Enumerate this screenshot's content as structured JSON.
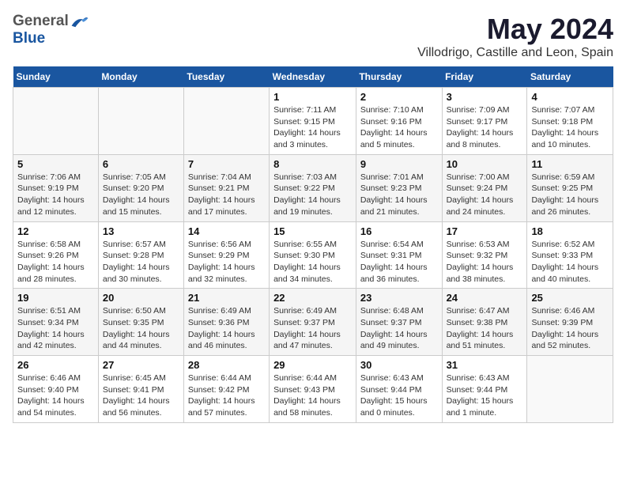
{
  "header": {
    "logo_general": "General",
    "logo_blue": "Blue",
    "title": "May 2024",
    "subtitle": "Villodrigo, Castille and Leon, Spain"
  },
  "weekdays": [
    "Sunday",
    "Monday",
    "Tuesday",
    "Wednesday",
    "Thursday",
    "Friday",
    "Saturday"
  ],
  "weeks": [
    [
      {
        "day": "",
        "info": ""
      },
      {
        "day": "",
        "info": ""
      },
      {
        "day": "",
        "info": ""
      },
      {
        "day": "1",
        "info": "Sunrise: 7:11 AM\nSunset: 9:15 PM\nDaylight: 14 hours and 3 minutes."
      },
      {
        "day": "2",
        "info": "Sunrise: 7:10 AM\nSunset: 9:16 PM\nDaylight: 14 hours and 5 minutes."
      },
      {
        "day": "3",
        "info": "Sunrise: 7:09 AM\nSunset: 9:17 PM\nDaylight: 14 hours and 8 minutes."
      },
      {
        "day": "4",
        "info": "Sunrise: 7:07 AM\nSunset: 9:18 PM\nDaylight: 14 hours and 10 minutes."
      }
    ],
    [
      {
        "day": "5",
        "info": "Sunrise: 7:06 AM\nSunset: 9:19 PM\nDaylight: 14 hours and 12 minutes."
      },
      {
        "day": "6",
        "info": "Sunrise: 7:05 AM\nSunset: 9:20 PM\nDaylight: 14 hours and 15 minutes."
      },
      {
        "day": "7",
        "info": "Sunrise: 7:04 AM\nSunset: 9:21 PM\nDaylight: 14 hours and 17 minutes."
      },
      {
        "day": "8",
        "info": "Sunrise: 7:03 AM\nSunset: 9:22 PM\nDaylight: 14 hours and 19 minutes."
      },
      {
        "day": "9",
        "info": "Sunrise: 7:01 AM\nSunset: 9:23 PM\nDaylight: 14 hours and 21 minutes."
      },
      {
        "day": "10",
        "info": "Sunrise: 7:00 AM\nSunset: 9:24 PM\nDaylight: 14 hours and 24 minutes."
      },
      {
        "day": "11",
        "info": "Sunrise: 6:59 AM\nSunset: 9:25 PM\nDaylight: 14 hours and 26 minutes."
      }
    ],
    [
      {
        "day": "12",
        "info": "Sunrise: 6:58 AM\nSunset: 9:26 PM\nDaylight: 14 hours and 28 minutes."
      },
      {
        "day": "13",
        "info": "Sunrise: 6:57 AM\nSunset: 9:28 PM\nDaylight: 14 hours and 30 minutes."
      },
      {
        "day": "14",
        "info": "Sunrise: 6:56 AM\nSunset: 9:29 PM\nDaylight: 14 hours and 32 minutes."
      },
      {
        "day": "15",
        "info": "Sunrise: 6:55 AM\nSunset: 9:30 PM\nDaylight: 14 hours and 34 minutes."
      },
      {
        "day": "16",
        "info": "Sunrise: 6:54 AM\nSunset: 9:31 PM\nDaylight: 14 hours and 36 minutes."
      },
      {
        "day": "17",
        "info": "Sunrise: 6:53 AM\nSunset: 9:32 PM\nDaylight: 14 hours and 38 minutes."
      },
      {
        "day": "18",
        "info": "Sunrise: 6:52 AM\nSunset: 9:33 PM\nDaylight: 14 hours and 40 minutes."
      }
    ],
    [
      {
        "day": "19",
        "info": "Sunrise: 6:51 AM\nSunset: 9:34 PM\nDaylight: 14 hours and 42 minutes."
      },
      {
        "day": "20",
        "info": "Sunrise: 6:50 AM\nSunset: 9:35 PM\nDaylight: 14 hours and 44 minutes."
      },
      {
        "day": "21",
        "info": "Sunrise: 6:49 AM\nSunset: 9:36 PM\nDaylight: 14 hours and 46 minutes."
      },
      {
        "day": "22",
        "info": "Sunrise: 6:49 AM\nSunset: 9:37 PM\nDaylight: 14 hours and 47 minutes."
      },
      {
        "day": "23",
        "info": "Sunrise: 6:48 AM\nSunset: 9:37 PM\nDaylight: 14 hours and 49 minutes."
      },
      {
        "day": "24",
        "info": "Sunrise: 6:47 AM\nSunset: 9:38 PM\nDaylight: 14 hours and 51 minutes."
      },
      {
        "day": "25",
        "info": "Sunrise: 6:46 AM\nSunset: 9:39 PM\nDaylight: 14 hours and 52 minutes."
      }
    ],
    [
      {
        "day": "26",
        "info": "Sunrise: 6:46 AM\nSunset: 9:40 PM\nDaylight: 14 hours and 54 minutes."
      },
      {
        "day": "27",
        "info": "Sunrise: 6:45 AM\nSunset: 9:41 PM\nDaylight: 14 hours and 56 minutes."
      },
      {
        "day": "28",
        "info": "Sunrise: 6:44 AM\nSunset: 9:42 PM\nDaylight: 14 hours and 57 minutes."
      },
      {
        "day": "29",
        "info": "Sunrise: 6:44 AM\nSunset: 9:43 PM\nDaylight: 14 hours and 58 minutes."
      },
      {
        "day": "30",
        "info": "Sunrise: 6:43 AM\nSunset: 9:44 PM\nDaylight: 15 hours and 0 minutes."
      },
      {
        "day": "31",
        "info": "Sunrise: 6:43 AM\nSunset: 9:44 PM\nDaylight: 15 hours and 1 minute."
      },
      {
        "day": "",
        "info": ""
      }
    ]
  ]
}
